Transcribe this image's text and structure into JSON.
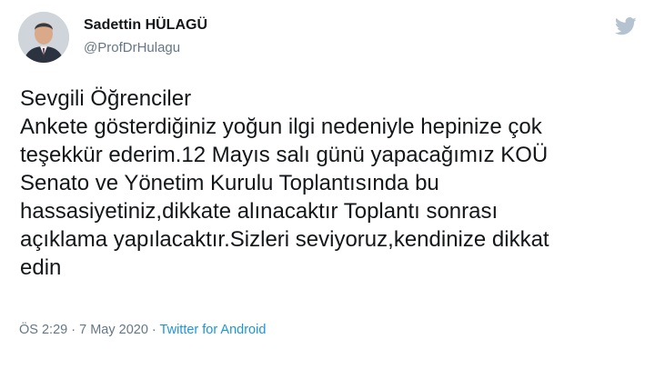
{
  "user": {
    "display_name": "Sadettin HÜLAGÜ",
    "handle": "@ProfDrHulagu"
  },
  "icons": {
    "platform_logo": "twitter-bird-icon"
  },
  "tweet": {
    "lines": [
      "Sevgili Öğrenciler",
      "Ankete gösterdiğiniz yoğun ilgi nedeniyle hepinize çok",
      "teşekkür ederim.12 Mayıs salı günü yapacağımız KOÜ",
      "Senato ve Yönetim Kurulu Toplantısında bu",
      "hassasiyetiniz,dikkate alınacaktır Toplantı sonrası",
      "açıklama yapılacaktır.Sizleri seviyoruz,kendinize dikkat",
      "edin"
    ]
  },
  "meta": {
    "time": "ÖS 2:29",
    "separator": "·",
    "date": "7 May 2020",
    "source": "Twitter for Android"
  },
  "colors": {
    "link": "#1b95e0",
    "secondary_text": "#657786",
    "logo": "#b4c3cf"
  }
}
